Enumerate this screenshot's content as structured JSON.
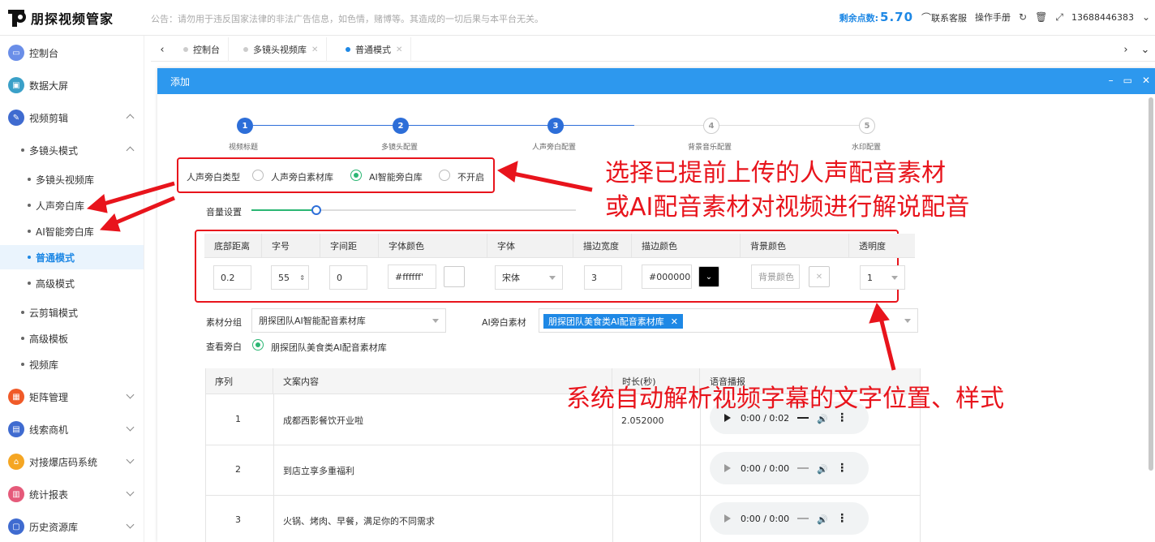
{
  "app": {
    "logo_text": "朋探视频管家",
    "notice": "公告：请勿用于违反国家法律的非法广告信息，如色情，赌博等。其造成的一切后果与本平台无关。",
    "points_label": "剩余点数:",
    "points_value": "5.70",
    "support": "联系客服",
    "manual": "操作手册",
    "user": "13688446383"
  },
  "sidebar": {
    "items": [
      {
        "label": "控制台",
        "color": "#6a8ee8"
      },
      {
        "label": "数据大屏",
        "color": "#3aa0c8"
      },
      {
        "label": "视频剪辑",
        "color": "#3f6bd0"
      },
      {
        "label": "多镜头模式"
      },
      {
        "label": "多镜头视频库"
      },
      {
        "label": "人声旁白库"
      },
      {
        "label": "AI智能旁白库"
      },
      {
        "label": "普通模式"
      },
      {
        "label": "高级模式"
      },
      {
        "label": "云剪辑模式"
      },
      {
        "label": "高级模板"
      },
      {
        "label": "视频库"
      },
      {
        "label": "矩阵管理",
        "color": "#f05a28"
      },
      {
        "label": "线索商机",
        "color": "#3f6bd0"
      },
      {
        "label": "对接爆店码系统",
        "color": "#f5a623"
      },
      {
        "label": "统计报表",
        "color": "#e55a7a"
      },
      {
        "label": "历史资源库",
        "color": "#3f6bd0"
      }
    ]
  },
  "tabs": [
    {
      "label": "控制台"
    },
    {
      "label": "多镜头视频库"
    },
    {
      "label": "普通模式"
    }
  ],
  "modal": {
    "title": "添加",
    "steps": [
      {
        "num": "1",
        "label": "视频标题"
      },
      {
        "num": "2",
        "label": "多镜头配置"
      },
      {
        "num": "3",
        "label": "人声旁白配置"
      },
      {
        "num": "4",
        "label": "背景音乐配置"
      },
      {
        "num": "5",
        "label": "水印配置"
      }
    ],
    "voice_type_label": "人声旁白类型",
    "voice_options": [
      "人声旁白素材库",
      "AI智能旁白库",
      "不开启"
    ],
    "volume_label": "音量设置",
    "volume_level": 0.2,
    "style_headers": [
      "底部距离",
      "字号",
      "字间距",
      "字体颜色",
      "字体",
      "描边宽度",
      "描边颜色",
      "背景颜色",
      "透明度"
    ],
    "style_values": {
      "bottom": "0.2",
      "size": "55",
      "spacing": "0",
      "font_color": "#ffffff'",
      "font": "宋体",
      "stroke_width": "3",
      "stroke_color": "#000000",
      "bg_placeholder": "背景颜色",
      "opacity": "1"
    },
    "group_label": "素材分组",
    "group_value": "朋探团队AI智能配音素材库",
    "ai_material_label": "AI旁白素材",
    "ai_material_tag": "朋探团队美食类AI配音素材库",
    "view_label": "查看旁白",
    "view_option": "朋探团队美食类AI配音素材库",
    "table_headers": [
      "序列",
      "文案内容",
      "时长(秒)",
      "语音播报"
    ],
    "rows": [
      {
        "seq": "1",
        "text": "成都西影餐饮开业啦",
        "duration": "2.052000",
        "audio": "0:00 / 0:02"
      },
      {
        "seq": "2",
        "text": "到店立享多重福利",
        "duration": "",
        "audio": "0:00 / 0:00"
      },
      {
        "seq": "3",
        "text": "火锅、烤肉、早餐，满足你的不同需求",
        "duration": "",
        "audio": "0:00 / 0:00"
      }
    ]
  },
  "annotations": {
    "line1": "选择已提前上传的人声配音素材",
    "line2": "或AI配音素材对视频进行解说配音",
    "line3": "系统自动解析视频字幕的文字位置、样式"
  }
}
